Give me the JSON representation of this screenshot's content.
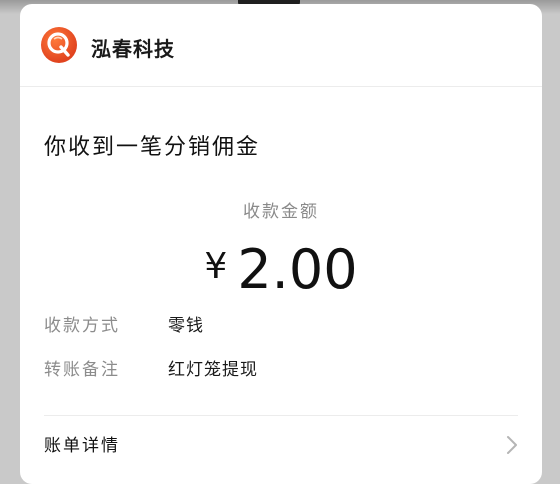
{
  "header": {
    "brand_name": "泓春科技",
    "logo_icon": "q-logo-icon",
    "logo_color": "#e8532a"
  },
  "notice": {
    "headline": "你收到一笔分销佣金"
  },
  "payment": {
    "amount_label": "收款金额",
    "currency_symbol": "¥",
    "amount": "2.00"
  },
  "details": [
    {
      "key": "收款方式",
      "value": "零钱"
    },
    {
      "key": "转账备注",
      "value": "红灯笼提现"
    }
  ],
  "footer": {
    "detail_label": "账单详情",
    "chevron_icon": "chevron-right-icon"
  }
}
